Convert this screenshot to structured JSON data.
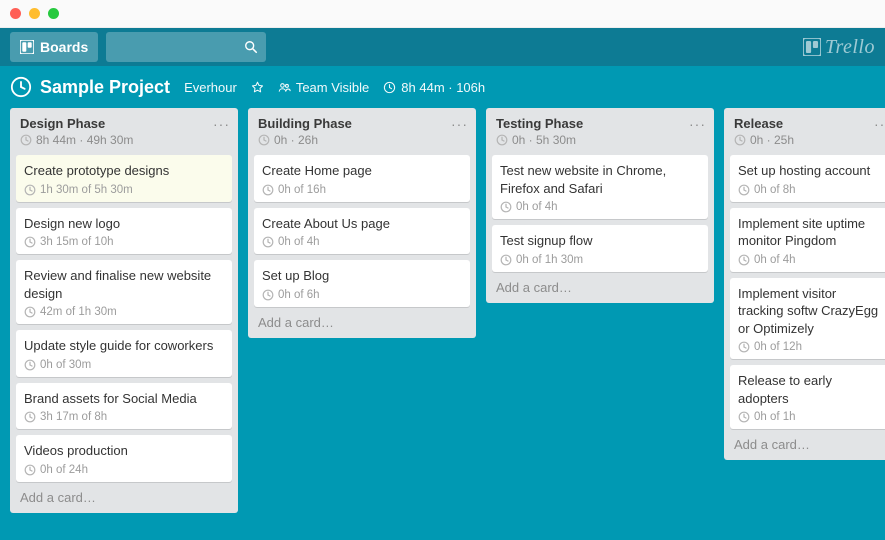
{
  "topbar": {
    "boards_label": "Boards",
    "brand": "Trello"
  },
  "board": {
    "title": "Sample Project",
    "powerup": "Everhour",
    "visibility": "Team Visible",
    "time_summary": "8h 44m · 106h"
  },
  "lists": [
    {
      "title": "Design Phase",
      "subtitle": "8h 44m · 49h 30m",
      "cards": [
        {
          "title": "Create prototype designs",
          "meta": "1h 30m of 5h 30m",
          "highlight": true
        },
        {
          "title": "Design new logo",
          "meta": "3h 15m of 10h"
        },
        {
          "title": "Review and finalise new website design",
          "meta": "42m of 1h 30m"
        },
        {
          "title": "Update style guide for coworkers",
          "meta": "0h of 30m"
        },
        {
          "title": "Brand assets for Social Media",
          "meta": "3h 17m of 8h"
        },
        {
          "title": "Videos production",
          "meta": "0h of 24h"
        }
      ],
      "add_label": "Add a card…"
    },
    {
      "title": "Building Phase",
      "subtitle": "0h · 26h",
      "cards": [
        {
          "title": "Create Home page",
          "meta": "0h of 16h"
        },
        {
          "title": "Create About Us page",
          "meta": "0h of 4h"
        },
        {
          "title": "Set up Blog",
          "meta": "0h of 6h"
        }
      ],
      "add_label": "Add a card…"
    },
    {
      "title": "Testing Phase",
      "subtitle": "0h · 5h 30m",
      "cards": [
        {
          "title": "Test new website in Chrome, Firefox and Safari",
          "meta": "0h of 4h"
        },
        {
          "title": "Test signup flow",
          "meta": "0h of 1h 30m"
        }
      ],
      "add_label": "Add a card…"
    },
    {
      "title": "Release",
      "subtitle": "0h · 25h",
      "cards": [
        {
          "title": "Set up hosting account",
          "meta": "0h of 8h"
        },
        {
          "title": "Implement site uptime monitor Pingdom",
          "meta": "0h of 4h"
        },
        {
          "title": "Implement visitor tracking softw CrazyEgg or Optimizely",
          "meta": "0h of 12h"
        },
        {
          "title": "Release to early adopters",
          "meta": "0h of 1h"
        }
      ],
      "add_label": "Add a card…"
    }
  ]
}
